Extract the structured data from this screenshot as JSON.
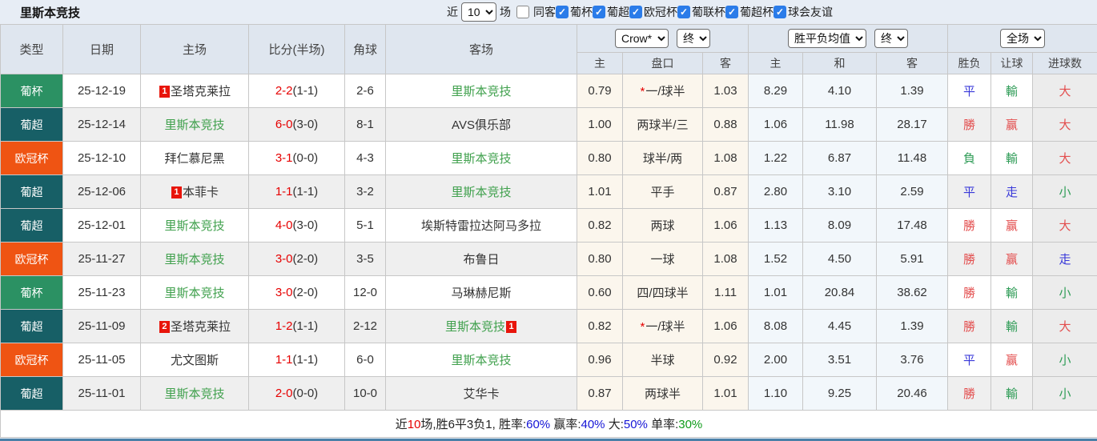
{
  "page": {
    "title": "里斯本竞技"
  },
  "toolbar": {
    "near_label": "近",
    "near_value": "10",
    "games_label": "场",
    "checkboxes": [
      {
        "label": "同客",
        "checked": false
      },
      {
        "label": "葡杯",
        "checked": true
      },
      {
        "label": "葡超",
        "checked": true
      },
      {
        "label": "欧冠杯",
        "checked": true
      },
      {
        "label": "葡联杯",
        "checked": true
      },
      {
        "label": "葡超杯",
        "checked": true
      },
      {
        "label": "球会友谊",
        "checked": true
      }
    ]
  },
  "selectors": {
    "odds_company": "Crow*",
    "odds_state": "终",
    "avg_name": "胜平负均值",
    "avg_state": "终",
    "scope": "全场"
  },
  "columns": {
    "type": "类型",
    "date": "日期",
    "home": "主场",
    "score": "比分(半场)",
    "corner": "角球",
    "away": "客场",
    "odds_home": "主",
    "odds_line": "盘口",
    "odds_away": "客",
    "avg_home": "主",
    "avg_draw": "和",
    "avg_away": "客",
    "result_wl": "胜负",
    "result_handicap": "让球",
    "result_goals": "进球数"
  },
  "competition_colors": {
    "葡杯": "#2b9163",
    "葡超": "#175f66",
    "欧冠杯": "#ef5413"
  },
  "rows": [
    {
      "comp": "葡杯",
      "date": "25-12-19",
      "home": {
        "badge": "1",
        "name": "圣塔克莱拉",
        "self": false
      },
      "score": {
        "ft": "2-2",
        "ht": "(1-1)"
      },
      "corners": "2-6",
      "away": {
        "name": "里斯本竞技",
        "badge": "",
        "self": true
      },
      "odds": {
        "home": "0.79",
        "star": true,
        "line": "一/球半",
        "away": "1.03"
      },
      "avg": {
        "home": "8.29",
        "draw": "4.10",
        "away": "1.39"
      },
      "res": {
        "wl": {
          "t": "平",
          "c": "blue"
        },
        "let": {
          "t": "輸",
          "c": "green"
        },
        "goal": {
          "t": "大",
          "c": "red"
        }
      }
    },
    {
      "comp": "葡超",
      "date": "25-12-14",
      "home": {
        "badge": "",
        "name": "里斯本竞技",
        "self": true
      },
      "score": {
        "ft": "6-0",
        "ht": "(3-0)"
      },
      "corners": "8-1",
      "away": {
        "name": "AVS俱乐部",
        "badge": "",
        "self": false
      },
      "odds": {
        "home": "1.00",
        "star": false,
        "line": "两球半/三",
        "away": "0.88"
      },
      "avg": {
        "home": "1.06",
        "draw": "11.98",
        "away": "28.17"
      },
      "res": {
        "wl": {
          "t": "勝",
          "c": "red"
        },
        "let": {
          "t": "赢",
          "c": "red"
        },
        "goal": {
          "t": "大",
          "c": "red"
        }
      }
    },
    {
      "comp": "欧冠杯",
      "date": "25-12-10",
      "home": {
        "badge": "",
        "name": "拜仁慕尼黑",
        "self": false
      },
      "score": {
        "ft": "3-1",
        "ht": "(0-0)"
      },
      "corners": "4-3",
      "away": {
        "name": "里斯本竞技",
        "badge": "",
        "self": true
      },
      "odds": {
        "home": "0.80",
        "star": false,
        "line": "球半/两",
        "away": "1.08"
      },
      "avg": {
        "home": "1.22",
        "draw": "6.87",
        "away": "11.48"
      },
      "res": {
        "wl": {
          "t": "負",
          "c": "green"
        },
        "let": {
          "t": "輸",
          "c": "green"
        },
        "goal": {
          "t": "大",
          "c": "red"
        }
      }
    },
    {
      "comp": "葡超",
      "date": "25-12-06",
      "home": {
        "badge": "1",
        "name": "本菲卡",
        "self": false
      },
      "score": {
        "ft": "1-1",
        "ht": "(1-1)"
      },
      "corners": "3-2",
      "away": {
        "name": "里斯本竞技",
        "badge": "",
        "self": true
      },
      "odds": {
        "home": "1.01",
        "star": false,
        "line": "平手",
        "away": "0.87"
      },
      "avg": {
        "home": "2.80",
        "draw": "3.10",
        "away": "2.59"
      },
      "res": {
        "wl": {
          "t": "平",
          "c": "blue"
        },
        "let": {
          "t": "走",
          "c": "blue"
        },
        "goal": {
          "t": "小",
          "c": "green"
        }
      }
    },
    {
      "comp": "葡超",
      "date": "25-12-01",
      "home": {
        "badge": "",
        "name": "里斯本竞技",
        "self": true
      },
      "score": {
        "ft": "4-0",
        "ht": "(3-0)"
      },
      "corners": "5-1",
      "away": {
        "name": "埃斯特雷拉达阿马多拉",
        "badge": "",
        "self": false
      },
      "odds": {
        "home": "0.82",
        "star": false,
        "line": "两球",
        "away": "1.06"
      },
      "avg": {
        "home": "1.13",
        "draw": "8.09",
        "away": "17.48"
      },
      "res": {
        "wl": {
          "t": "勝",
          "c": "red"
        },
        "let": {
          "t": "赢",
          "c": "red"
        },
        "goal": {
          "t": "大",
          "c": "red"
        }
      }
    },
    {
      "comp": "欧冠杯",
      "date": "25-11-27",
      "home": {
        "badge": "",
        "name": "里斯本竞技",
        "self": true
      },
      "score": {
        "ft": "3-0",
        "ht": "(2-0)"
      },
      "corners": "3-5",
      "away": {
        "name": "布鲁日",
        "badge": "",
        "self": false
      },
      "odds": {
        "home": "0.80",
        "star": false,
        "line": "一球",
        "away": "1.08"
      },
      "avg": {
        "home": "1.52",
        "draw": "4.50",
        "away": "5.91"
      },
      "res": {
        "wl": {
          "t": "勝",
          "c": "red"
        },
        "let": {
          "t": "赢",
          "c": "red"
        },
        "goal": {
          "t": "走",
          "c": "blue"
        }
      }
    },
    {
      "comp": "葡杯",
      "date": "25-11-23",
      "home": {
        "badge": "",
        "name": "里斯本竞技",
        "self": true
      },
      "score": {
        "ft": "3-0",
        "ht": "(2-0)"
      },
      "corners": "12-0",
      "away": {
        "name": "马琳赫尼斯",
        "badge": "",
        "self": false
      },
      "odds": {
        "home": "0.60",
        "star": false,
        "line": "四/四球半",
        "away": "1.11"
      },
      "avg": {
        "home": "1.01",
        "draw": "20.84",
        "away": "38.62"
      },
      "res": {
        "wl": {
          "t": "勝",
          "c": "red"
        },
        "let": {
          "t": "輸",
          "c": "green"
        },
        "goal": {
          "t": "小",
          "c": "green"
        }
      }
    },
    {
      "comp": "葡超",
      "date": "25-11-09",
      "home": {
        "badge": "2",
        "name": "圣塔克莱拉",
        "self": false
      },
      "score": {
        "ft": "1-2",
        "ht": "(1-1)"
      },
      "corners": "2-12",
      "away": {
        "name": "里斯本竞技",
        "badge": "1",
        "self": true
      },
      "odds": {
        "home": "0.82",
        "star": true,
        "line": "一/球半",
        "away": "1.06"
      },
      "avg": {
        "home": "8.08",
        "draw": "4.45",
        "away": "1.39"
      },
      "res": {
        "wl": {
          "t": "勝",
          "c": "red"
        },
        "let": {
          "t": "輸",
          "c": "green"
        },
        "goal": {
          "t": "大",
          "c": "red"
        }
      }
    },
    {
      "comp": "欧冠杯",
      "date": "25-11-05",
      "home": {
        "badge": "",
        "name": "尤文图斯",
        "self": false
      },
      "score": {
        "ft": "1-1",
        "ht": "(1-1)"
      },
      "corners": "6-0",
      "away": {
        "name": "里斯本竞技",
        "badge": "",
        "self": true
      },
      "odds": {
        "home": "0.96",
        "star": false,
        "line": "半球",
        "away": "0.92"
      },
      "avg": {
        "home": "2.00",
        "draw": "3.51",
        "away": "3.76"
      },
      "res": {
        "wl": {
          "t": "平",
          "c": "blue"
        },
        "let": {
          "t": "赢",
          "c": "red"
        },
        "goal": {
          "t": "小",
          "c": "green"
        }
      }
    },
    {
      "comp": "葡超",
      "date": "25-11-01",
      "home": {
        "badge": "",
        "name": "里斯本竞技",
        "self": true
      },
      "score": {
        "ft": "2-0",
        "ht": "(0-0)"
      },
      "corners": "10-0",
      "away": {
        "name": "艾华卡",
        "badge": "",
        "self": false
      },
      "odds": {
        "home": "0.87",
        "star": false,
        "line": "两球半",
        "away": "1.01"
      },
      "avg": {
        "home": "1.10",
        "draw": "9.25",
        "away": "20.46"
      },
      "res": {
        "wl": {
          "t": "勝",
          "c": "red"
        },
        "let": {
          "t": "輸",
          "c": "green"
        },
        "goal": {
          "t": "小",
          "c": "green"
        }
      }
    }
  ],
  "footer": {
    "segments": [
      {
        "t": "近",
        "c": "black"
      },
      {
        "t": "10",
        "c": "red"
      },
      {
        "t": "场,胜6平3负1, 胜率:",
        "c": "black"
      },
      {
        "t": "60%",
        "c": "blue"
      },
      {
        "t": " 赢率:",
        "c": "black"
      },
      {
        "t": "40%",
        "c": "blue"
      },
      {
        "t": " 大:",
        "c": "black"
      },
      {
        "t": "50%",
        "c": "blue"
      },
      {
        "t": " 单率:",
        "c": "black"
      },
      {
        "t": "30%",
        "c": "green"
      }
    ]
  }
}
